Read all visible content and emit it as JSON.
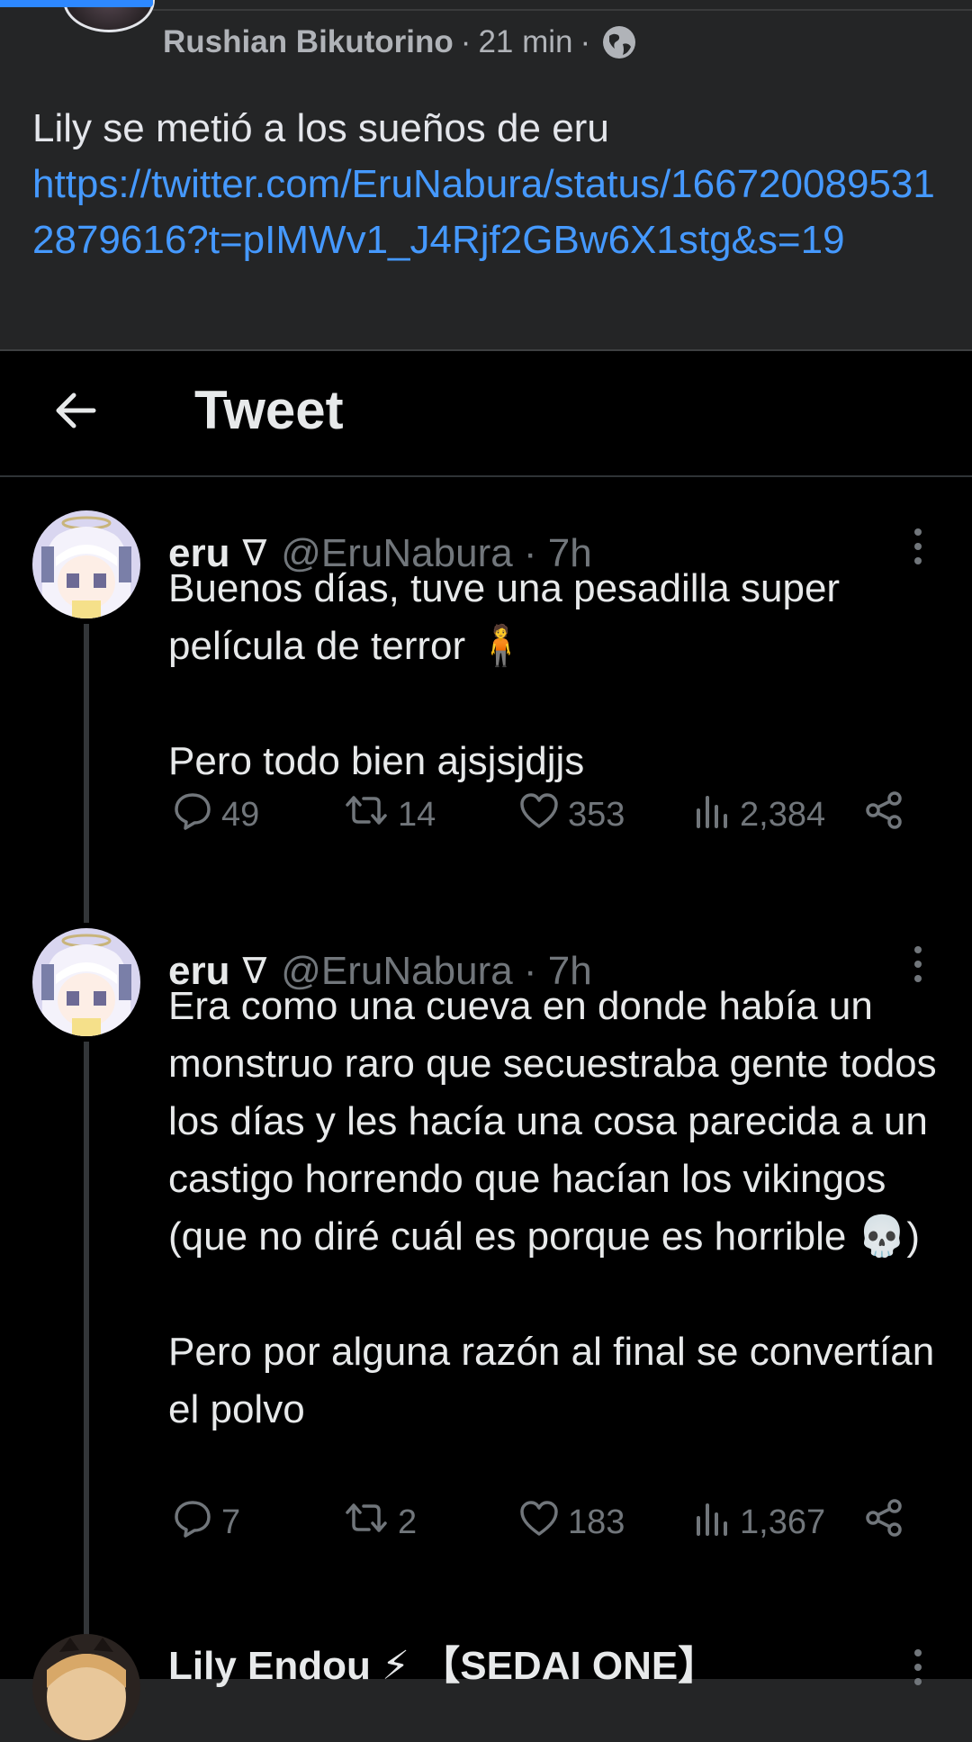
{
  "facebook_post": {
    "author": "Rushian Bikutorino",
    "time": "21 min",
    "separator": "·",
    "privacy_icon": "globe-icon",
    "text": "Lily se metió a los sueños de eru",
    "link": "https://twitter.com/EruNabura/status/1667200895312879616?t=pIMWv1_J4Rjf2GBw6X1stg&s=19",
    "link_color": "#4599ff"
  },
  "tweet_screen": {
    "header_title": "Tweet",
    "back_icon": "arrow-left-icon",
    "tweets": [
      {
        "name": "eru",
        "badge": "∇",
        "handle": "@EruNabura · 7h",
        "paragraphs": [
          "Buenos días, tuve una pesadilla super película de terror 🧍",
          "Pero todo bien ajsjsjdjjs"
        ],
        "replies": "49",
        "retweets": "14",
        "likes": "353",
        "views": "2,384"
      },
      {
        "name": "eru",
        "badge": "∇",
        "handle": "@EruNabura · 7h",
        "paragraphs": [
          "Era como una cueva en donde había un monstruo raro que secuestraba gente todos los días y les hacía una cosa parecida a un castigo horrendo que hacían los vikingos (que no diré cuál es porque es horrible 💀)",
          "Pero por alguna razón al final se convertían el polvo"
        ],
        "replies": "7",
        "retweets": "2",
        "likes": "183",
        "views": "1,367"
      },
      {
        "name": "Lily Endou ⚡ 【SEDAI ONE】"
      }
    ]
  }
}
